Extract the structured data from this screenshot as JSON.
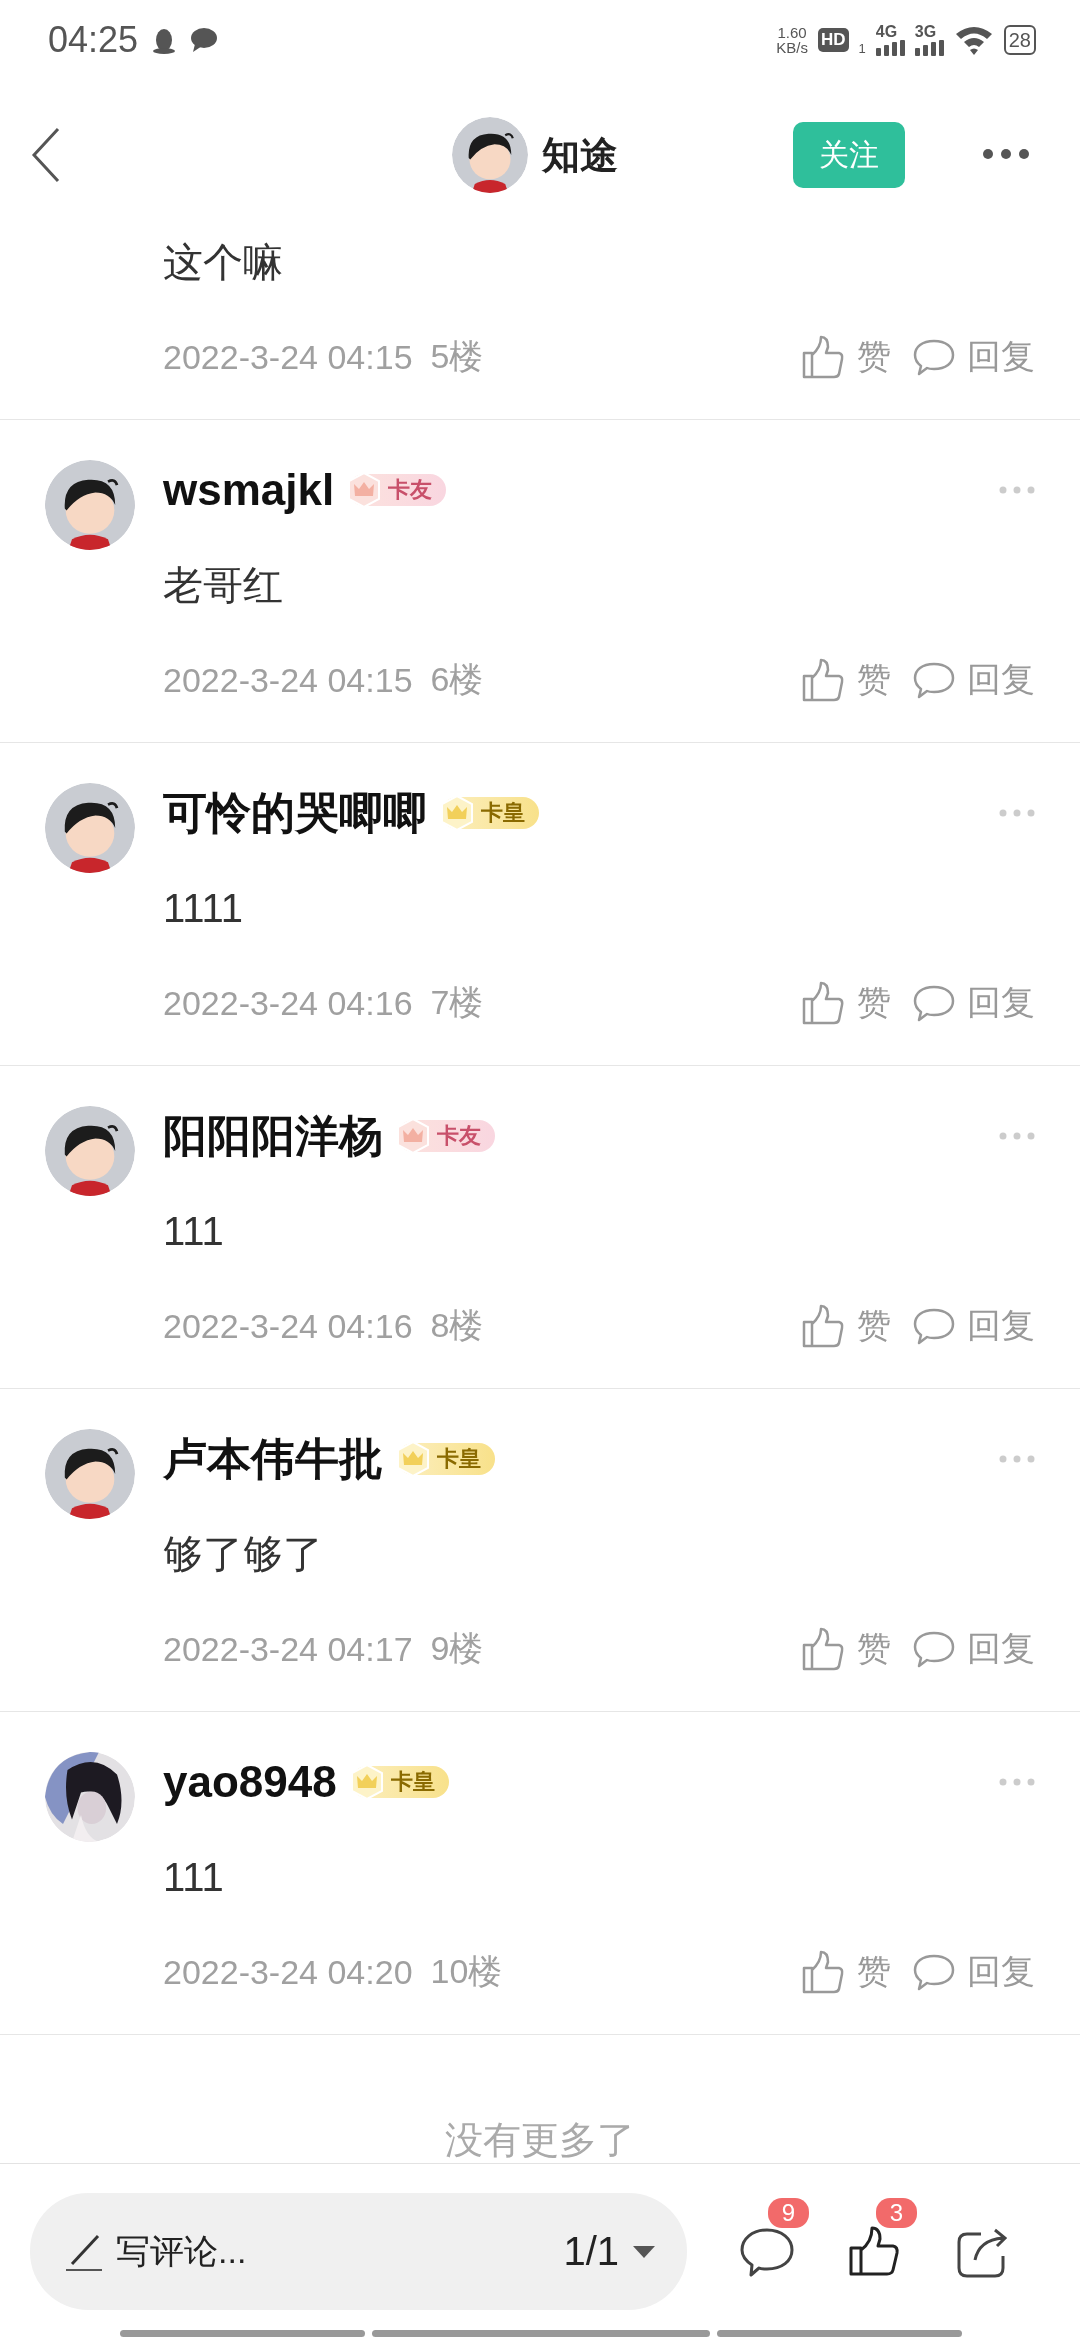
{
  "status_bar": {
    "time": "04:25",
    "net_speed": "1.60",
    "net_unit": "KB/s",
    "hd": "HD",
    "hd_sub": "1",
    "net_1": "4G",
    "net_2": "3G",
    "battery": "28"
  },
  "header": {
    "author": "知途",
    "follow_button": "关注",
    "avatar": {
      "kind": "default"
    }
  },
  "comments": [
    {
      "content": "这个嘛",
      "time": "2022-3-24 04:15",
      "floor": "5楼",
      "like": "赞",
      "reply": "回复"
    },
    {
      "avatar": {
        "kind": "default"
      },
      "name": "wsmajkl",
      "badge": {
        "kind": "friend",
        "label": "卡友"
      },
      "content": "老哥红",
      "time": "2022-3-24 04:15",
      "floor": "6楼",
      "like": "赞",
      "reply": "回复"
    },
    {
      "avatar": {
        "kind": "default"
      },
      "name": "可怜的哭唧唧",
      "badge": {
        "kind": "emperor",
        "label": "卡皇"
      },
      "content": "1111",
      "time": "2022-3-24 04:16",
      "floor": "7楼",
      "like": "赞",
      "reply": "回复"
    },
    {
      "avatar": {
        "kind": "default"
      },
      "name": "阳阳阳洋杨",
      "badge": {
        "kind": "friend",
        "label": "卡友"
      },
      "content": "111",
      "time": "2022-3-24 04:16",
      "floor": "8楼",
      "like": "赞",
      "reply": "回复"
    },
    {
      "avatar": {
        "kind": "default"
      },
      "name": "卢本伟牛批",
      "badge": {
        "kind": "emperor",
        "label": "卡皇"
      },
      "content": "够了够了",
      "time": "2022-3-24 04:17",
      "floor": "9楼",
      "like": "赞",
      "reply": "回复"
    },
    {
      "name": "yao8948",
      "badge": {
        "kind": "emperor",
        "label": "卡皇"
      },
      "content": "111",
      "time": "2022-3-24 04:20",
      "floor": "10楼",
      "like": "赞",
      "reply": "回复"
    }
  ],
  "footer": "没有更多了",
  "bottom_bar": {
    "placeholder": "写评论...",
    "page": "1/1",
    "comment_count": "9",
    "like_count": "3"
  }
}
